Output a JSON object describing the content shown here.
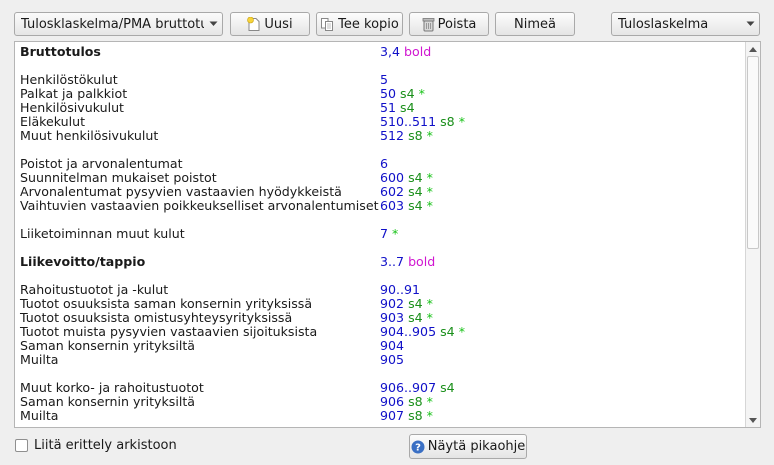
{
  "toolbar": {
    "report_select": "Tulosklaskelma/PMA bruttotulos",
    "new_label": "Uusi",
    "copy_label": "Tee kopio",
    "delete_label": "Poista",
    "rename_label": "Nimeä",
    "type_select": "Tuloslaskelma"
  },
  "rows": [
    {
      "label": "Bruttotulos",
      "bold": true,
      "num": "3,4",
      "style": "",
      "star": "",
      "extra": "bold"
    },
    {
      "label": "",
      "num": "",
      "style": "",
      "star": "",
      "extra": ""
    },
    {
      "label": "Henkilöstökulut",
      "num": "5",
      "style": "",
      "star": "",
      "extra": ""
    },
    {
      "label": "Palkat ja palkkiot",
      "num": "50",
      "style": "s4",
      "star": "*",
      "extra": ""
    },
    {
      "label": "Henkilösivukulut",
      "num": "51",
      "style": "s4",
      "star": "",
      "extra": ""
    },
    {
      "label": "Eläkekulut",
      "num": "510..511",
      "style": "s8",
      "star": "*",
      "extra": ""
    },
    {
      "label": "Muut henkilösivukulut",
      "num": "512",
      "style": "s8",
      "star": "*",
      "extra": ""
    },
    {
      "label": "",
      "num": "",
      "style": "",
      "star": "",
      "extra": ""
    },
    {
      "label": "Poistot ja arvonalentumat",
      "num": "6",
      "style": "",
      "star": "",
      "extra": ""
    },
    {
      "label": "Suunnitelman mukaiset poistot",
      "num": "600",
      "style": "s4",
      "star": "*",
      "extra": ""
    },
    {
      "label": "Arvonalentumat pysyvien vastaavien hyödykkeistä",
      "num": "602",
      "style": "s4",
      "star": "*",
      "extra": ""
    },
    {
      "label": "Vaihtuvien vastaavien poikkeukselliset arvonalentumiset",
      "num": "603",
      "style": "s4",
      "star": "*",
      "extra": ""
    },
    {
      "label": "",
      "num": "",
      "style": "",
      "star": "",
      "extra": ""
    },
    {
      "label": "Liiketoiminnan muut kulut",
      "num": "7",
      "style": "",
      "star": "*",
      "extra": ""
    },
    {
      "label": "",
      "num": "",
      "style": "",
      "star": "",
      "extra": ""
    },
    {
      "label": "Liikevoitto/tappio",
      "bold": true,
      "num": "3..7",
      "style": "",
      "star": "",
      "extra": "bold"
    },
    {
      "label": "",
      "num": "",
      "style": "",
      "star": "",
      "extra": ""
    },
    {
      "label": "Rahoitustuotot ja -kulut",
      "num": "90..91",
      "style": "",
      "star": "",
      "extra": ""
    },
    {
      "label": "Tuotot osuuksista saman konsernin yrityksissä",
      "num": "902",
      "style": "s4",
      "star": "*",
      "extra": ""
    },
    {
      "label": "Tuotot osuuksista omistusyhteysyrityksissä",
      "num": "903",
      "style": "s4",
      "star": "*",
      "extra": ""
    },
    {
      "label": "Tuotot muista pysyvien vastaavien sijoituksista",
      "num": "904..905",
      "style": "s4",
      "star": "*",
      "extra": ""
    },
    {
      "label": "Saman konsernin yrityksiltä",
      "num": "904",
      "style": "",
      "star": "",
      "extra": ""
    },
    {
      "label": "Muilta",
      "num": "905",
      "style": "",
      "star": "",
      "extra": ""
    },
    {
      "label": "",
      "num": "",
      "style": "",
      "star": "",
      "extra": ""
    },
    {
      "label": "Muut korko- ja rahoitustuotot",
      "num": "906..907",
      "style": "s4",
      "star": "",
      "extra": ""
    },
    {
      "label": "Saman konsernin yrityksiltä",
      "num": "906",
      "style": "s8",
      "star": "*",
      "extra": ""
    },
    {
      "label": "Muilta",
      "num": "907",
      "style": "s8",
      "star": "*",
      "extra": ""
    }
  ],
  "scroll": {
    "position": 0.0,
    "visible_fraction": 0.54
  },
  "bottom": {
    "attach_label": "Liitä erittely arkistoon",
    "attach_checked": false,
    "help_label": "Näytä pikaohje"
  },
  "colors": {
    "number": "#1010c8",
    "style": "#1a8f1a",
    "star": "#16c216",
    "bold_tag": "#d016d0"
  },
  "icons": {
    "new": "new-document-icon",
    "copy": "copy-document-icon",
    "delete": "trash-icon",
    "help": "help-question-icon"
  }
}
